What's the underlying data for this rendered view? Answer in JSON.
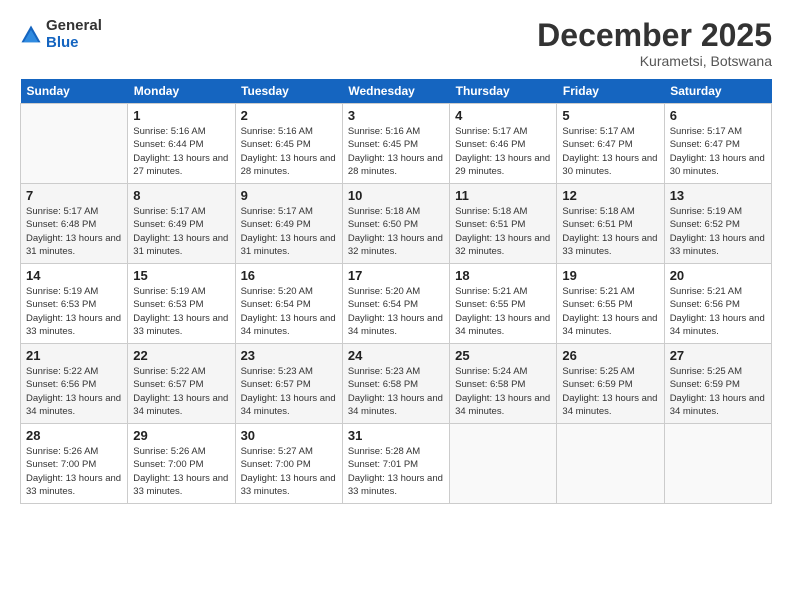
{
  "logo": {
    "general": "General",
    "blue": "Blue"
  },
  "title": "December 2025",
  "location": "Kurametsi, Botswana",
  "days_header": [
    "Sunday",
    "Monday",
    "Tuesday",
    "Wednesday",
    "Thursday",
    "Friday",
    "Saturday"
  ],
  "weeks": [
    [
      {
        "num": "",
        "empty": true
      },
      {
        "num": "1",
        "sunrise": "Sunrise: 5:16 AM",
        "sunset": "Sunset: 6:44 PM",
        "daylight": "Daylight: 13 hours and 27 minutes."
      },
      {
        "num": "2",
        "sunrise": "Sunrise: 5:16 AM",
        "sunset": "Sunset: 6:45 PM",
        "daylight": "Daylight: 13 hours and 28 minutes."
      },
      {
        "num": "3",
        "sunrise": "Sunrise: 5:16 AM",
        "sunset": "Sunset: 6:45 PM",
        "daylight": "Daylight: 13 hours and 28 minutes."
      },
      {
        "num": "4",
        "sunrise": "Sunrise: 5:17 AM",
        "sunset": "Sunset: 6:46 PM",
        "daylight": "Daylight: 13 hours and 29 minutes."
      },
      {
        "num": "5",
        "sunrise": "Sunrise: 5:17 AM",
        "sunset": "Sunset: 6:47 PM",
        "daylight": "Daylight: 13 hours and 30 minutes."
      },
      {
        "num": "6",
        "sunrise": "Sunrise: 5:17 AM",
        "sunset": "Sunset: 6:47 PM",
        "daylight": "Daylight: 13 hours and 30 minutes."
      }
    ],
    [
      {
        "num": "7",
        "sunrise": "Sunrise: 5:17 AM",
        "sunset": "Sunset: 6:48 PM",
        "daylight": "Daylight: 13 hours and 31 minutes."
      },
      {
        "num": "8",
        "sunrise": "Sunrise: 5:17 AM",
        "sunset": "Sunset: 6:49 PM",
        "daylight": "Daylight: 13 hours and 31 minutes."
      },
      {
        "num": "9",
        "sunrise": "Sunrise: 5:17 AM",
        "sunset": "Sunset: 6:49 PM",
        "daylight": "Daylight: 13 hours and 31 minutes."
      },
      {
        "num": "10",
        "sunrise": "Sunrise: 5:18 AM",
        "sunset": "Sunset: 6:50 PM",
        "daylight": "Daylight: 13 hours and 32 minutes."
      },
      {
        "num": "11",
        "sunrise": "Sunrise: 5:18 AM",
        "sunset": "Sunset: 6:51 PM",
        "daylight": "Daylight: 13 hours and 32 minutes."
      },
      {
        "num": "12",
        "sunrise": "Sunrise: 5:18 AM",
        "sunset": "Sunset: 6:51 PM",
        "daylight": "Daylight: 13 hours and 33 minutes."
      },
      {
        "num": "13",
        "sunrise": "Sunrise: 5:19 AM",
        "sunset": "Sunset: 6:52 PM",
        "daylight": "Daylight: 13 hours and 33 minutes."
      }
    ],
    [
      {
        "num": "14",
        "sunrise": "Sunrise: 5:19 AM",
        "sunset": "Sunset: 6:53 PM",
        "daylight": "Daylight: 13 hours and 33 minutes."
      },
      {
        "num": "15",
        "sunrise": "Sunrise: 5:19 AM",
        "sunset": "Sunset: 6:53 PM",
        "daylight": "Daylight: 13 hours and 33 minutes."
      },
      {
        "num": "16",
        "sunrise": "Sunrise: 5:20 AM",
        "sunset": "Sunset: 6:54 PM",
        "daylight": "Daylight: 13 hours and 34 minutes."
      },
      {
        "num": "17",
        "sunrise": "Sunrise: 5:20 AM",
        "sunset": "Sunset: 6:54 PM",
        "daylight": "Daylight: 13 hours and 34 minutes."
      },
      {
        "num": "18",
        "sunrise": "Sunrise: 5:21 AM",
        "sunset": "Sunset: 6:55 PM",
        "daylight": "Daylight: 13 hours and 34 minutes."
      },
      {
        "num": "19",
        "sunrise": "Sunrise: 5:21 AM",
        "sunset": "Sunset: 6:55 PM",
        "daylight": "Daylight: 13 hours and 34 minutes."
      },
      {
        "num": "20",
        "sunrise": "Sunrise: 5:21 AM",
        "sunset": "Sunset: 6:56 PM",
        "daylight": "Daylight: 13 hours and 34 minutes."
      }
    ],
    [
      {
        "num": "21",
        "sunrise": "Sunrise: 5:22 AM",
        "sunset": "Sunset: 6:56 PM",
        "daylight": "Daylight: 13 hours and 34 minutes."
      },
      {
        "num": "22",
        "sunrise": "Sunrise: 5:22 AM",
        "sunset": "Sunset: 6:57 PM",
        "daylight": "Daylight: 13 hours and 34 minutes."
      },
      {
        "num": "23",
        "sunrise": "Sunrise: 5:23 AM",
        "sunset": "Sunset: 6:57 PM",
        "daylight": "Daylight: 13 hours and 34 minutes."
      },
      {
        "num": "24",
        "sunrise": "Sunrise: 5:23 AM",
        "sunset": "Sunset: 6:58 PM",
        "daylight": "Daylight: 13 hours and 34 minutes."
      },
      {
        "num": "25",
        "sunrise": "Sunrise: 5:24 AM",
        "sunset": "Sunset: 6:58 PM",
        "daylight": "Daylight: 13 hours and 34 minutes."
      },
      {
        "num": "26",
        "sunrise": "Sunrise: 5:25 AM",
        "sunset": "Sunset: 6:59 PM",
        "daylight": "Daylight: 13 hours and 34 minutes."
      },
      {
        "num": "27",
        "sunrise": "Sunrise: 5:25 AM",
        "sunset": "Sunset: 6:59 PM",
        "daylight": "Daylight: 13 hours and 34 minutes."
      }
    ],
    [
      {
        "num": "28",
        "sunrise": "Sunrise: 5:26 AM",
        "sunset": "Sunset: 7:00 PM",
        "daylight": "Daylight: 13 hours and 33 minutes."
      },
      {
        "num": "29",
        "sunrise": "Sunrise: 5:26 AM",
        "sunset": "Sunset: 7:00 PM",
        "daylight": "Daylight: 13 hours and 33 minutes."
      },
      {
        "num": "30",
        "sunrise": "Sunrise: 5:27 AM",
        "sunset": "Sunset: 7:00 PM",
        "daylight": "Daylight: 13 hours and 33 minutes."
      },
      {
        "num": "31",
        "sunrise": "Sunrise: 5:28 AM",
        "sunset": "Sunset: 7:01 PM",
        "daylight": "Daylight: 13 hours and 33 minutes."
      },
      {
        "num": "",
        "empty": true
      },
      {
        "num": "",
        "empty": true
      },
      {
        "num": "",
        "empty": true
      }
    ]
  ]
}
